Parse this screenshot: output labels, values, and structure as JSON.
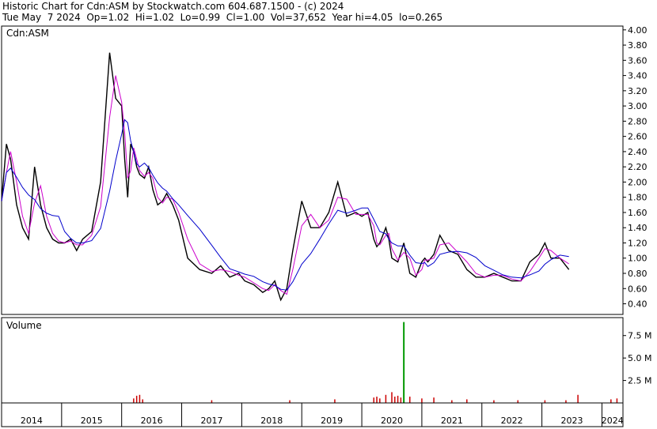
{
  "header": {
    "line1": "Historic Chart for Cdn:ASM by Stockwatch.com 604.687.1500 - (c) 2024",
    "line2": "Tue May  7 2024  Op=1.02  Hi=1.02  Lo=0.99  Cl=1.00  Vol=37,652  Year hi=4.05  lo=0.265"
  },
  "colors": {
    "price": "#000000",
    "ma_short": "#cc00cc",
    "ma_long": "#0000cc",
    "volume": "#cc0000",
    "volume_spike": "#009900",
    "frame": "#000000"
  },
  "chart_data": [
    {
      "type": "line",
      "title": "Cdn:ASM",
      "ylim": [
        0.26,
        4.05
      ],
      "yticks": [
        "4.00",
        "3.80",
        "3.60",
        "3.40",
        "3.20",
        "3.00",
        "2.80",
        "2.60",
        "2.40",
        "2.20",
        "2.00",
        "1.80",
        "1.60",
        "1.40",
        "1.20",
        "1.00",
        "0.80",
        "0.60",
        "0.40"
      ],
      "xlim": [
        2014.0,
        2024.35
      ],
      "x": [
        2014.0,
        2014.08,
        2014.15,
        2014.25,
        2014.35,
        2014.45,
        2014.55,
        2014.65,
        2014.75,
        2014.85,
        2014.95,
        2015.05,
        2015.15,
        2015.25,
        2015.35,
        2015.5,
        2015.65,
        2015.8,
        2015.9,
        2016.0,
        2016.05,
        2016.1,
        2016.15,
        2016.2,
        2016.25,
        2016.3,
        2016.38,
        2016.45,
        2016.52,
        2016.6,
        2016.68,
        2016.75,
        2016.85,
        2016.95,
        2017.1,
        2017.3,
        2017.5,
        2017.65,
        2017.8,
        2017.95,
        2018.05,
        2018.2,
        2018.35,
        2018.45,
        2018.55,
        2018.65,
        2018.75,
        2018.85,
        2019.0,
        2019.15,
        2019.3,
        2019.45,
        2019.6,
        2019.75,
        2019.9,
        2020.0,
        2020.1,
        2020.2,
        2020.25,
        2020.3,
        2020.4,
        2020.45,
        2020.5,
        2020.6,
        2020.7,
        2020.8,
        2020.9,
        2021.0,
        2021.05,
        2021.1,
        2021.2,
        2021.3,
        2021.45,
        2021.6,
        2021.75,
        2021.9,
        2022.05,
        2022.2,
        2022.35,
        2022.5,
        2022.65,
        2022.8,
        2022.95,
        2023.05,
        2023.15,
        2023.3,
        2023.45,
        2023.6,
        2023.75,
        2023.9,
        2024.0,
        2024.1,
        2024.15,
        2024.2,
        2024.25,
        2024.3,
        2024.35
      ],
      "series": [
        {
          "values": [
            1.75,
            2.5,
            2.3,
            1.7,
            1.4,
            1.25,
            2.2,
            1.7,
            1.4,
            1.25,
            1.2,
            1.2,
            1.25,
            1.1,
            1.25,
            1.35,
            2.0,
            3.7,
            3.1,
            3.0,
            2.3,
            1.8,
            2.5,
            2.4,
            2.2,
            2.1,
            2.05,
            2.2,
            1.9,
            1.7,
            1.75,
            1.85,
            1.7,
            1.5,
            1.0,
            0.85,
            0.8,
            0.9,
            0.75,
            0.8,
            0.7,
            0.65,
            0.55,
            0.6,
            0.7,
            0.45,
            0.6,
            1.1,
            1.75,
            1.4,
            1.4,
            1.6,
            2.0,
            1.55,
            1.6,
            1.55,
            1.6,
            1.25,
            1.15,
            1.2,
            1.4,
            1.25,
            1.0,
            0.95,
            1.2,
            0.8,
            0.75,
            0.95,
            1.0,
            0.95,
            1.05,
            1.3,
            1.1,
            1.05,
            0.85,
            0.75,
            0.75,
            0.8,
            0.75,
            0.7,
            0.7,
            0.95,
            1.05,
            1.2,
            1.0,
            1.0,
            0.85
          ],
          "values_note": ""
        }
      ]
    },
    {
      "type": "bar",
      "title": "Volume",
      "ylim": [
        0,
        9.5
      ],
      "yticks": [
        "7.5 M",
        "5.0 M",
        "2.5 M"
      ],
      "xlim": [
        2014.0,
        2024.35
      ],
      "x": [
        2016.2,
        2016.25,
        2016.3,
        2016.35,
        2017.5,
        2018.8,
        2019.55,
        2020.2,
        2020.25,
        2020.3,
        2020.4,
        2020.5,
        2020.55,
        2020.6,
        2020.65,
        2020.7,
        2020.8,
        2021.0,
        2021.2,
        2021.5,
        2021.75,
        2022.2,
        2022.6,
        2023.05,
        2023.4,
        2023.6,
        2024.15,
        2024.25
      ],
      "values": [
        0.5,
        0.8,
        0.9,
        0.4,
        0.3,
        0.3,
        0.4,
        0.6,
        0.7,
        0.5,
        0.9,
        1.2,
        0.7,
        0.8,
        0.6,
        2.6,
        0.7,
        0.5,
        0.6,
        0.3,
        0.4,
        0.3,
        0.3,
        0.3,
        0.3,
        0.9,
        0.4,
        0.5
      ],
      "spike": {
        "x": 2020.7,
        "value": 9.0
      }
    }
  ],
  "xaxis": {
    "years": [
      "2014",
      "2015",
      "2016",
      "2017",
      "2018",
      "2019",
      "2020",
      "2021",
      "2022",
      "2023",
      "2024"
    ]
  }
}
